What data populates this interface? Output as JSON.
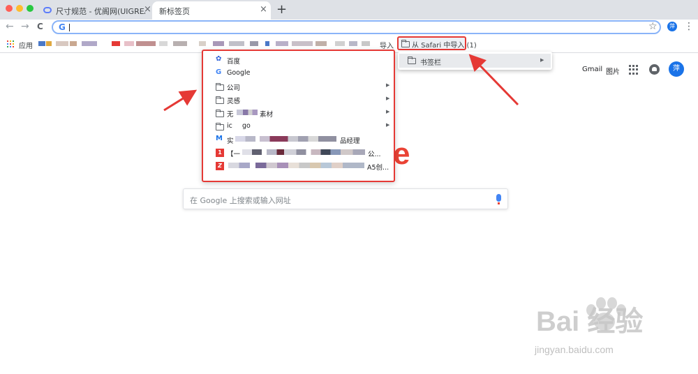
{
  "window": {
    "traffic_lights": [
      "#ff5f57",
      "#febc2e",
      "#28c840"
    ]
  },
  "tabs": [
    {
      "label": "尺寸规范 - 优阁网(UIGREAT) - I",
      "close": "×",
      "active": false
    },
    {
      "label": "新标签页",
      "close": "×",
      "active": true
    }
  ],
  "toolbar": {
    "new_tab": "+",
    "back": "←",
    "forward": "→",
    "reload": "C",
    "google_mark": "G",
    "star": "☆",
    "profile_initial": "萍",
    "menu": "⋮"
  },
  "bookmarks_bar": {
    "apps_label": "应用",
    "import_label": "导入",
    "safari_folder": "从 Safari 中导入 (1)",
    "apps_dot_colors": [
      "#ea4335",
      "#fbbc05",
      "#34a853",
      "#4285f4",
      "#ea4335",
      "#fbbc05",
      "#34a853",
      "#4285f4",
      "#ea4335"
    ]
  },
  "submenu": {
    "item": "书签栏",
    "arrow": "▶"
  },
  "dropdown": {
    "items": [
      {
        "label": "百度",
        "icon": "baidu-paw-icon",
        "has_arrow": false
      },
      {
        "label": "Google",
        "icon": "google-g-icon",
        "has_arrow": false
      },
      {
        "label": "公司",
        "icon": "folder-icon",
        "has_arrow": true
      },
      {
        "label": "灵感",
        "icon": "folder-icon",
        "has_arrow": true
      },
      {
        "label": "无",
        "label_tail": "素材",
        "icon": "folder-icon",
        "has_arrow": true
      },
      {
        "label": "ic",
        "label_tail": "go",
        "icon": "folder-icon",
        "has_arrow": true
      },
      {
        "label": "实",
        "label_tail": "品经理",
        "icon": "m-logo-icon",
        "has_arrow": false
      },
      {
        "label": "【一",
        "label_tail": "公...",
        "icon": "red-1-icon",
        "has_arrow": false
      },
      {
        "label": "",
        "label_tail": "A5创...",
        "icon": "red-z-icon",
        "has_arrow": false
      }
    ],
    "arrow": "▶"
  },
  "google_header": {
    "gmail": "Gmail",
    "images": "图片",
    "profile_initial": "萍"
  },
  "ntp": {
    "logo_fragment": "e",
    "search_placeholder": "在 Google 上搜索或输入网址"
  },
  "watermark": {
    "brand": "Bai  经验",
    "url": "jingyan.baidu.com"
  },
  "annotation_color": "#e53935"
}
